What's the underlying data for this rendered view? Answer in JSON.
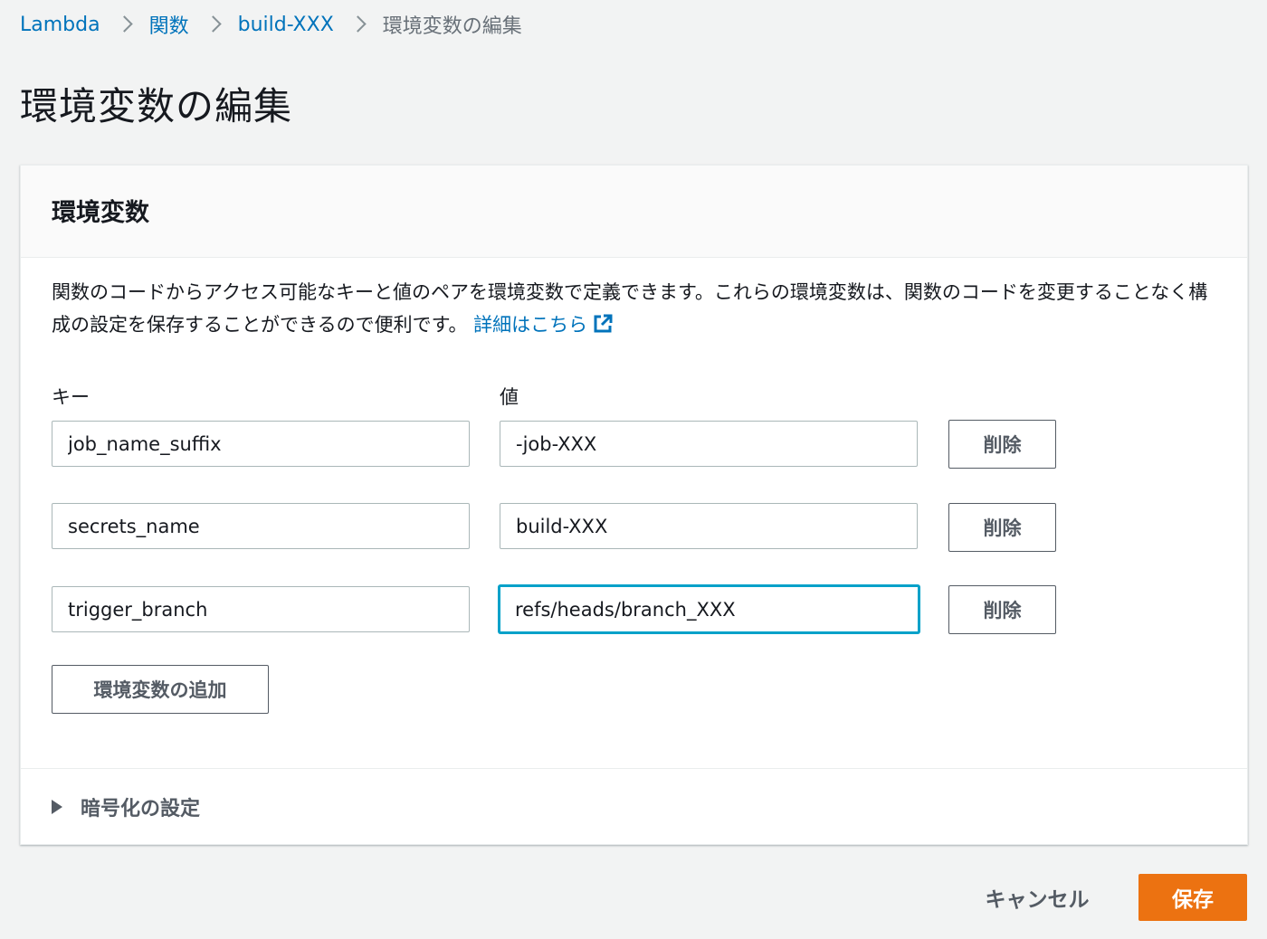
{
  "breadcrumb": {
    "items": [
      "Lambda",
      "関数",
      "build-XXX"
    ],
    "current": "環境変数の編集"
  },
  "page": {
    "title": "環境変数の編集"
  },
  "panel": {
    "title": "環境変数",
    "description": "関数のコードからアクセス可能なキーと値のペアを環境変数で定義できます。これらの環境変数は、関数のコードを変更することなく構成の設定を保存することができるので便利です。",
    "learn_more": "詳細はこちら",
    "key_label": "キー",
    "value_label": "値",
    "remove_label": "削除",
    "add_label": "環境変数の追加",
    "variables": [
      {
        "key": "job_name_suffix",
        "value": "-job-XXX"
      },
      {
        "key": "secrets_name",
        "value": "build-XXX"
      },
      {
        "key": "trigger_branch",
        "value": "refs/heads/branch_XXX"
      }
    ],
    "encryption": {
      "label": "暗号化の設定",
      "icon": "caret-right-icon"
    }
  },
  "actions": {
    "cancel": "キャンセル",
    "save": "保存"
  },
  "colors": {
    "link": "#0073bb",
    "primary": "#ec7211",
    "focus": "#00a1c9",
    "background": "#f2f3f3"
  }
}
